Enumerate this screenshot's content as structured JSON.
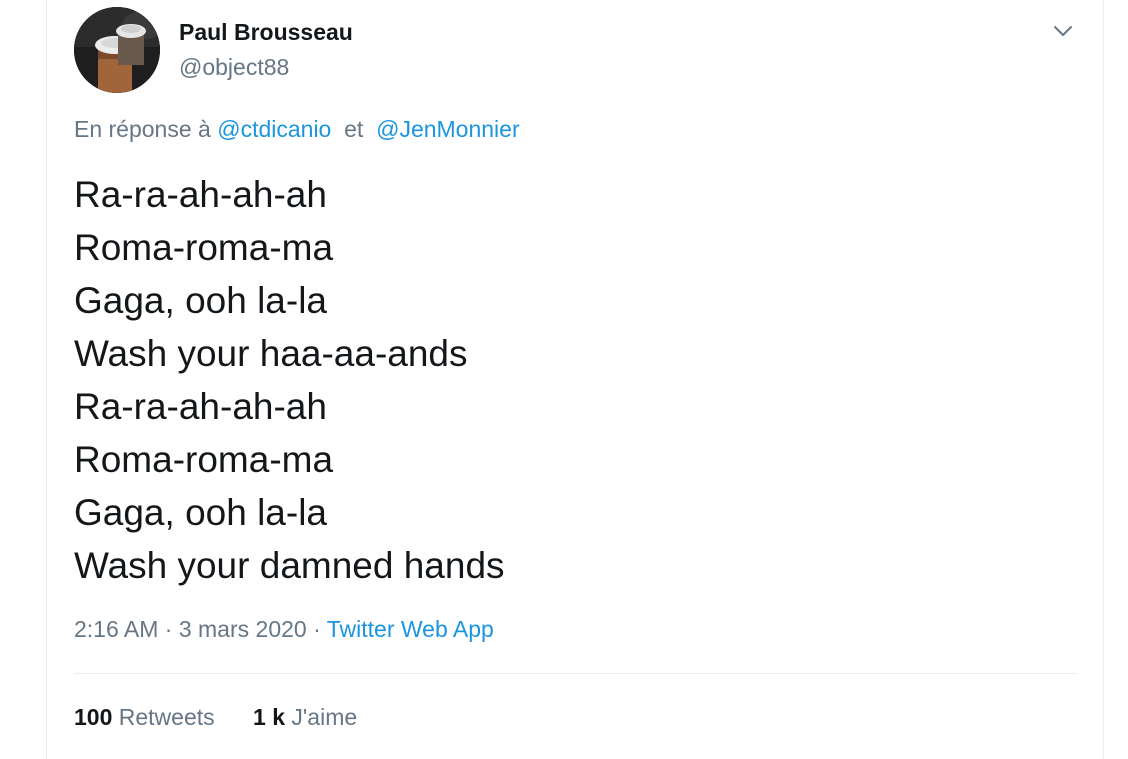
{
  "author": {
    "name": "Paul Brousseau",
    "handle": "@object88"
  },
  "reply": {
    "prefix": "En réponse à",
    "mention1": "@ctdicanio",
    "conjunction": "et",
    "mention2": "@JenMonnier"
  },
  "tweet": {
    "lines": [
      "Ra-ra-ah-ah-ah",
      "Roma-roma-ma",
      "Gaga, ooh la-la",
      "Wash your haa-aa-ands",
      "Ra-ra-ah-ah-ah",
      "Roma-roma-ma",
      "Gaga, ooh la-la",
      "Wash your damned hands"
    ]
  },
  "meta": {
    "time": "2:16 AM",
    "separator": "·",
    "date": "3 mars 2020",
    "source": "Twitter Web App"
  },
  "stats": {
    "retweets_count": "100",
    "retweets_label": "Retweets",
    "likes_count": "1 k",
    "likes_label": "J'aime"
  },
  "icons": {
    "menu": "chevron-down-icon"
  },
  "colors": {
    "text": "#14171a",
    "secondary": "#657786",
    "link": "#1b95e0",
    "divider": "#e6ecf0"
  }
}
